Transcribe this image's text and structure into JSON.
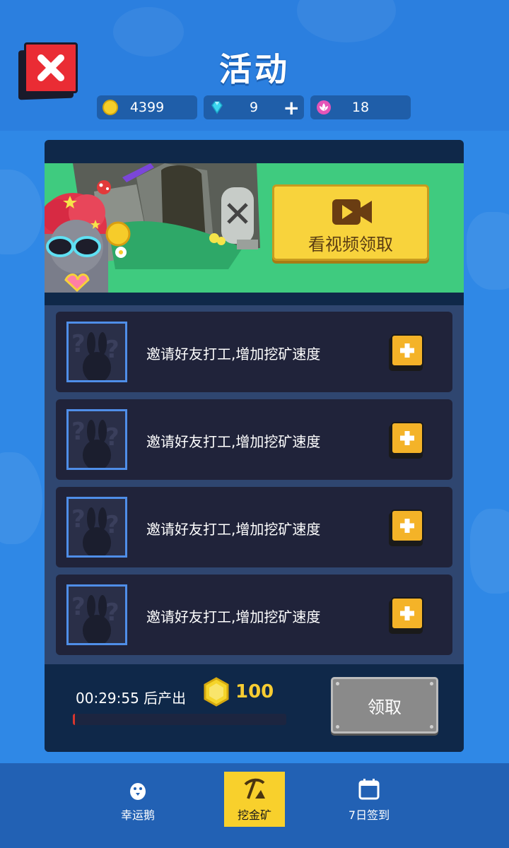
{
  "header": {
    "title": "活动",
    "close_icon": "close-x-icon"
  },
  "currencies": [
    {
      "icon": "gold-coin-icon",
      "value": "4399",
      "color": "#f5cf2a"
    },
    {
      "icon": "diamond-icon",
      "value": "9",
      "plus": "+",
      "color": "#3bd6f0"
    },
    {
      "icon": "lotus-icon",
      "value": "18",
      "color": "#e455b8"
    }
  ],
  "banner": {
    "video_button_label": "看视频领取",
    "video_icon": "video-camera-icon"
  },
  "invite_rows": [
    {
      "text": "邀请好友打工,增加挖矿速度",
      "avatar_icon": "unknown-bunny-avatar-icon",
      "action_icon": "plus-icon"
    },
    {
      "text": "邀请好友打工,增加挖矿速度",
      "avatar_icon": "unknown-bunny-avatar-icon",
      "action_icon": "plus-icon"
    },
    {
      "text": "邀请好友打工,增加挖矿速度",
      "avatar_icon": "unknown-bunny-avatar-icon",
      "action_icon": "plus-icon"
    },
    {
      "text": "邀请好友打工,增加挖矿速度",
      "avatar_icon": "unknown-bunny-avatar-icon",
      "action_icon": "plus-icon"
    }
  ],
  "production": {
    "timer_text": "00:29:55 后产出",
    "reward_value": "100",
    "reward_icon": "gold-coin-icon",
    "progress_fraction": 0.01,
    "claim_label": "领取"
  },
  "tabs": [
    {
      "label": "幸运鹅",
      "icon": "goose-icon",
      "active": false
    },
    {
      "label": "挖金矿",
      "icon": "pickaxe-mine-icon",
      "active": true
    },
    {
      "label": "7日签到",
      "icon": "calendar-icon",
      "active": false
    }
  ],
  "colors": {
    "background": "#2f88e6",
    "panel": "#0f2849",
    "accent_yellow": "#f8d02c",
    "close_red": "#ea2c34"
  }
}
